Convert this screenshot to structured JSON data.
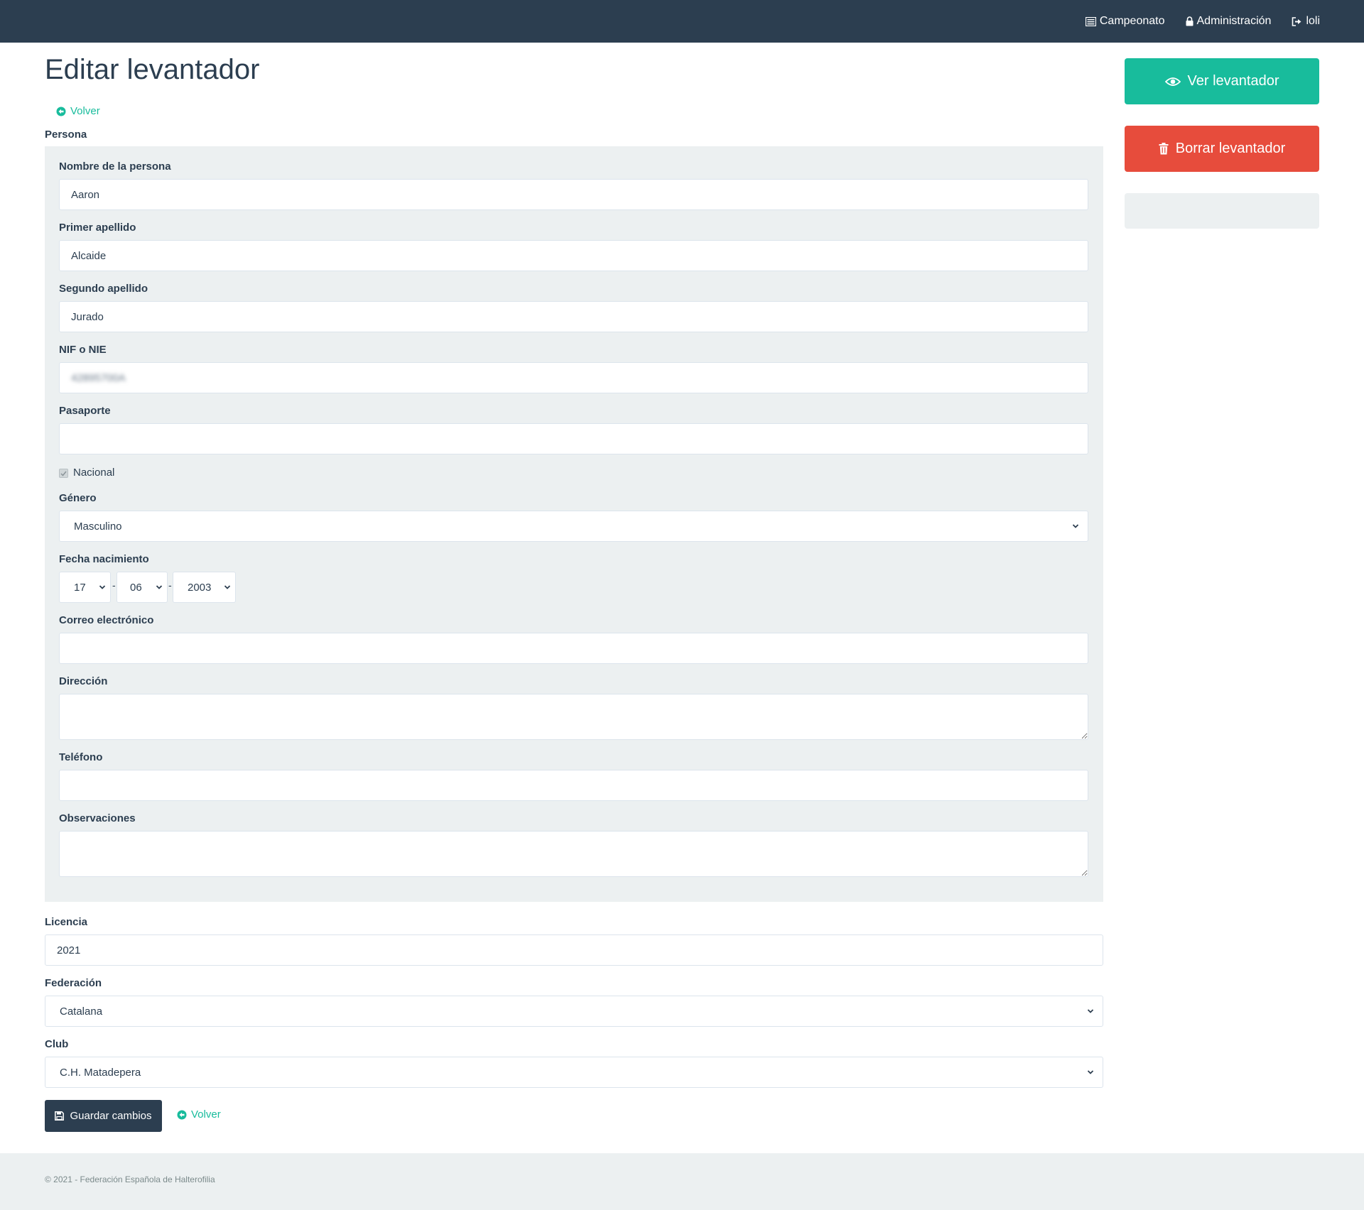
{
  "nav": {
    "items": [
      {
        "label": "Campeonato",
        "icon": "list-icon"
      },
      {
        "label": "Administración",
        "icon": "lock-icon"
      },
      {
        "label": "loli",
        "icon": "sign-out-icon"
      }
    ]
  },
  "page": {
    "title": "Editar levantador",
    "back_label": "Volver"
  },
  "persona": {
    "section_label": "Persona",
    "nombre": {
      "label": "Nombre de la persona",
      "value": "Aaron"
    },
    "primer_apellido": {
      "label": "Primer apellido",
      "value": "Alcaide"
    },
    "segundo_apellido": {
      "label": "Segundo apellido",
      "value": "Jurado"
    },
    "nif": {
      "label": "NIF o NIE",
      "value": "42895700A"
    },
    "pasaporte": {
      "label": "Pasaporte",
      "value": ""
    },
    "nacional": {
      "label": "Nacional",
      "checked": true
    },
    "genero": {
      "label": "Género",
      "value": "Masculino"
    },
    "fecha": {
      "label": "Fecha nacimiento",
      "day": "17",
      "month": "06",
      "year": "2003",
      "separator": "-"
    },
    "correo": {
      "label": "Correo electrónico",
      "value": ""
    },
    "direccion": {
      "label": "Dirección",
      "value": ""
    },
    "telefono": {
      "label": "Teléfono",
      "value": ""
    },
    "observaciones": {
      "label": "Observaciones",
      "value": ""
    }
  },
  "licencia": {
    "label": "Licencia",
    "value": "2021"
  },
  "federacion": {
    "label": "Federación",
    "value": "Catalana"
  },
  "club": {
    "label": "Club",
    "value": "C.H. Matadepera"
  },
  "actions": {
    "save_label": "Guardar cambios",
    "back_label": "Volver"
  },
  "sidebar": {
    "ver_label": "Ver levantador",
    "borrar_label": "Borrar levantador"
  },
  "colors": {
    "primary": "#2c3e50",
    "success": "#18bc9c",
    "danger": "#e74c3c",
    "well": "#ecf0f1"
  },
  "footer": {
    "text": "© 2021 - Federación Española de Halterofilia"
  }
}
